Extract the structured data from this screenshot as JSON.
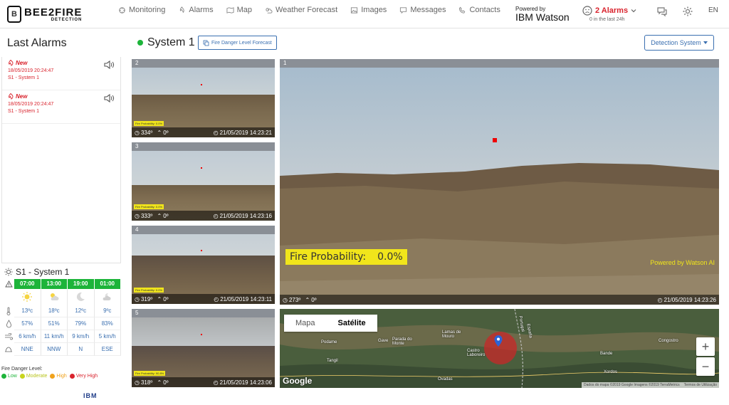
{
  "header": {
    "logo_mark": "B",
    "logo_text": "BEE2FIRE",
    "logo_sub": "DETECTION",
    "nav": [
      {
        "label": "Monitoring",
        "icon": "monitoring-icon"
      },
      {
        "label": "Alarms",
        "icon": "alarms-icon"
      },
      {
        "label": "Map",
        "icon": "map-icon"
      },
      {
        "label": "Weather Forecast",
        "icon": "weather-icon"
      },
      {
        "label": "Images",
        "icon": "images-icon"
      },
      {
        "label": "Messages",
        "icon": "messages-icon"
      },
      {
        "label": "Contacts",
        "icon": "contacts-icon"
      }
    ],
    "powered_by": "Powered by",
    "ibm_watson": "IBM Watson",
    "alarms_count": "2 Alarms",
    "alarms_sub": "0 in the last 24h",
    "lang": "EN"
  },
  "left": {
    "title": "Last Alarms",
    "alarms": [
      {
        "status": "New",
        "date": "18/05/2019 20:24:47",
        "system": "S1 - System 1"
      },
      {
        "status": "New",
        "date": "18/05/2019 20:24:47",
        "system": "S1 - System 1"
      }
    ]
  },
  "weather": {
    "system": "S1 - System 1",
    "times": [
      "07:00",
      "13:00",
      "19:00",
      "01:00"
    ],
    "icons": [
      "sun-icon",
      "partly-cloudy-icon",
      "moon-icon",
      "cloudy-night-icon"
    ],
    "temps": [
      "13ºc",
      "18ºc",
      "12ºc",
      "9ºc"
    ],
    "humidity": [
      "57%",
      "51%",
      "79%",
      "83%"
    ],
    "wind": [
      "6 km/h",
      "11 km/h",
      "9 km/h",
      "5 km/h"
    ],
    "direction": [
      "NNE",
      "NNW",
      "N",
      "ESE"
    ],
    "colors": {
      "header": "#1db43a",
      "value": "#3a6fb0"
    }
  },
  "fire_danger": {
    "label": "Fire Danger Level:",
    "levels": [
      {
        "name": "Low",
        "color": "#1db43a"
      },
      {
        "name": "Moderate",
        "color": "#c8d41c"
      },
      {
        "name": "High",
        "color": "#f0a21c"
      },
      {
        "name": "Very High",
        "color": "#d9232d"
      }
    ]
  },
  "ibm_footer": "IBM",
  "system": {
    "name": "System 1",
    "forecast_btn": "Fire Danger Level Forecast",
    "detection_btn": "Detection System"
  },
  "cameras": [
    {
      "id": "2",
      "heading": "334º",
      "tilt": "0º",
      "time": "21/05/2019 14:23:21",
      "fp": "Fire Probability: 0.0%"
    },
    {
      "id": "3",
      "heading": "333º",
      "tilt": "0º",
      "time": "21/05/2019 14:23:16",
      "fp": "Fire Probability: 0.0%"
    },
    {
      "id": "4",
      "heading": "319º",
      "tilt": "0º",
      "time": "21/05/2019 14:23:11",
      "fp": "Fire Probability: 0.0%"
    },
    {
      "id": "5",
      "heading": "318º",
      "tilt": "0º",
      "time": "21/05/2019 14:23:06",
      "fp": "Fire Probability: 90.8%"
    }
  ],
  "main_camera": {
    "id": "1",
    "fp_label": "Fire Probability:",
    "fp_value": "0.0%",
    "watson_ai": "Powered by Watson AI",
    "heading": "273º",
    "tilt": "0º",
    "time": "21/05/2019 14:23:26"
  },
  "map": {
    "tab_map": "Mapa",
    "tab_sat": "Satélite",
    "zoom_in": "+",
    "zoom_out": "−",
    "google": "Google",
    "attribution": "Dados do mapa ©2019 Google Imagens ©2019 TerraMetrics",
    "terms": "Termos de Utilização",
    "places": [
      "Podame",
      "Tangil",
      "Gave",
      "Parada do Monte",
      "Lamas de Mouro",
      "Castro Laboreiro",
      "Bande",
      "Congostro",
      "Xordos",
      "Portugal",
      "España",
      "Ovadas"
    ]
  }
}
